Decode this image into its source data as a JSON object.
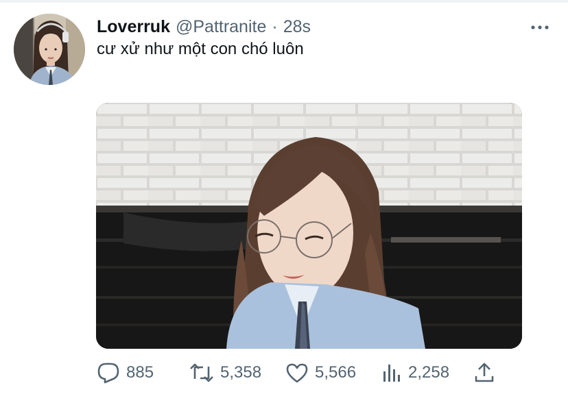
{
  "tweet": {
    "author": {
      "display_name": "Loverruk",
      "handle": "@Pattranite",
      "avatar_icon": "profile-photo"
    },
    "separator": "·",
    "time": "28s",
    "text": "cư xử như một con chó luôn",
    "media": {
      "kind": "photo",
      "icon": "photo-girl-glasses"
    },
    "actions": {
      "replies": "885",
      "retweets": "5,358",
      "likes": "5,566",
      "views": "2,258"
    }
  },
  "icons": {
    "more": "more-horizontal-icon",
    "reply": "reply-icon",
    "retweet": "retweet-icon",
    "like": "heart-icon",
    "views": "views-bar-chart-icon",
    "share": "share-upload-icon"
  },
  "colors": {
    "text_primary": "#0f1419",
    "text_secondary": "#536471",
    "background": "#ffffff"
  }
}
